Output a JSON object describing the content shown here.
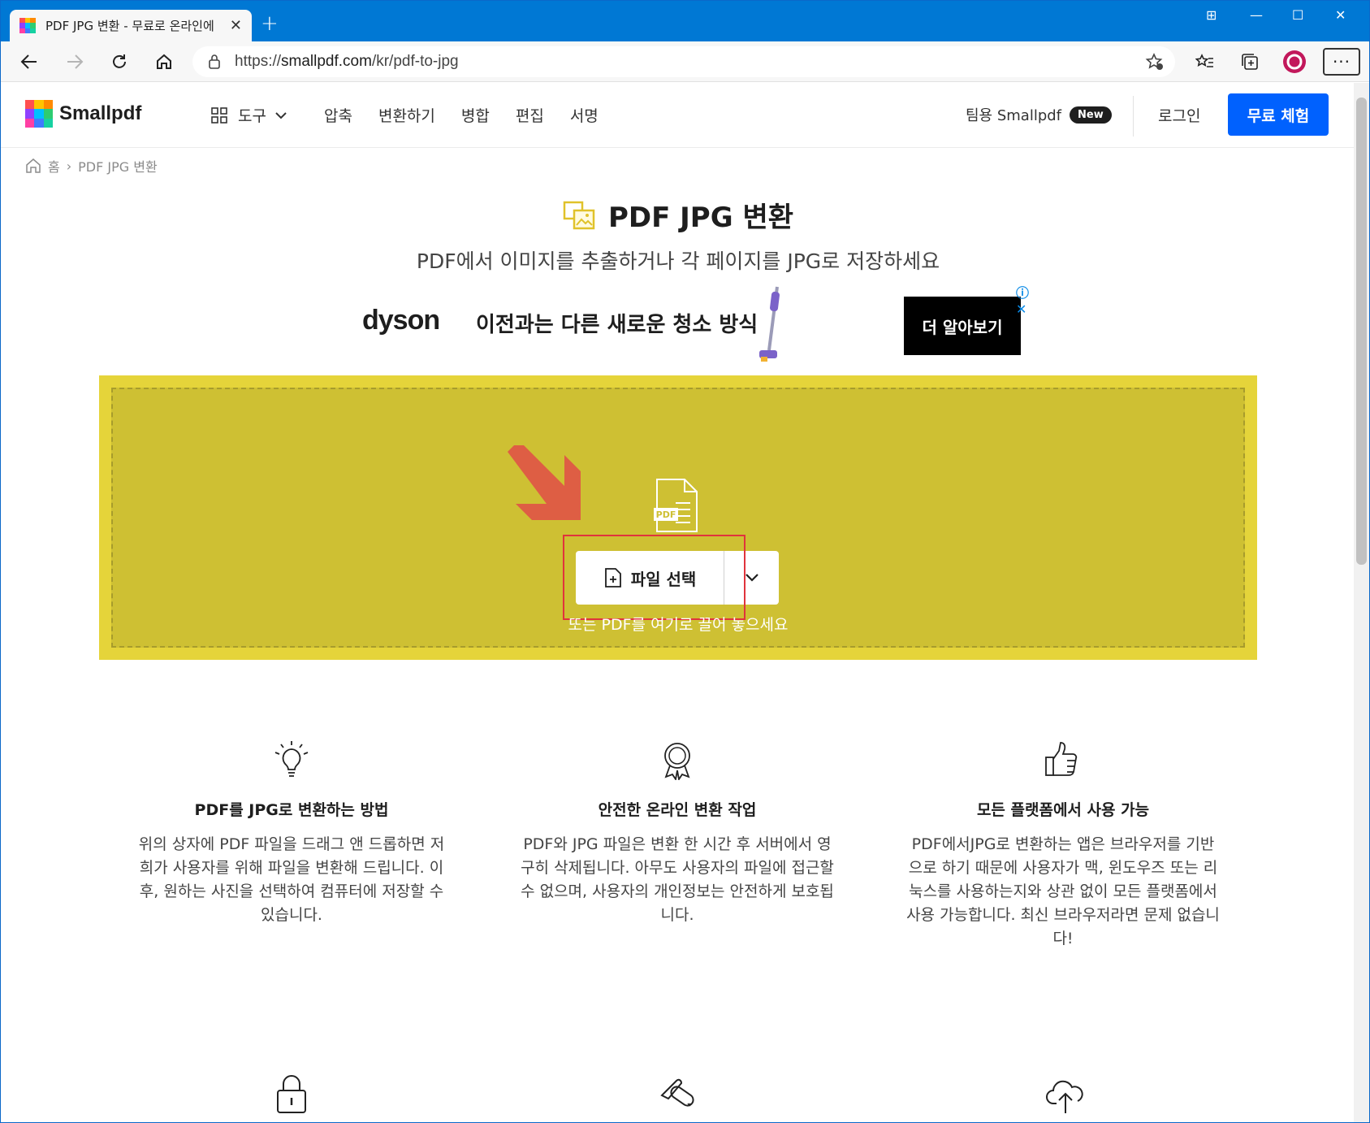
{
  "browser": {
    "tab_title": "PDF JPG 변환 - 무료로 온라인에",
    "url_prefix": "https://",
    "url_host": "smallpdf.com",
    "url_path": "/kr/pdf-to-jpg",
    "colors": {
      "titlebar": "#0078d4",
      "accent": "#0061fe"
    }
  },
  "header": {
    "logo_text": "Smallpdf",
    "tools_label": "도구",
    "menu": [
      "압축",
      "변환하기",
      "병합",
      "편집",
      "서명"
    ],
    "team_label": "팀용 Smallpdf",
    "team_badge": "New",
    "login_label": "로그인",
    "cta_label": "무료 체험"
  },
  "breadcrumb": {
    "home": "홈",
    "separator": "›",
    "current": "PDF JPG 변환"
  },
  "hero": {
    "title": "PDF JPG 변환",
    "subtitle": "PDF에서 이미지를 추출하거나 각 페이지를 JPG로 저장하세요"
  },
  "ad": {
    "brand": "dyson",
    "headline": "이전과는 다른 새로운 청소 방식",
    "button": "더 알아보기"
  },
  "dropzone": {
    "file_icon_label": "PDF",
    "choose_file": "파일 선택",
    "hint": "또는 PDF를 여기로 끌어 놓으세요",
    "colors": {
      "outer": "#e5d43a",
      "inner": "#cec033"
    }
  },
  "features": [
    {
      "icon": "lightbulb-icon",
      "title": "PDF를 JPG로 변환하는 방법",
      "body": "위의 상자에 PDF 파일을 드래그 앤 드롭하면 저희가 사용자를 위해 파일을 변환해 드립니다. 이후, 원하는 사진을 선택하여 컴퓨터에 저장할 수 있습니다."
    },
    {
      "icon": "award-icon",
      "title": "안전한 온라인 변환 작업",
      "body": "PDF와 JPG 파일은 변환 한 시간 후 서버에서 영구히 삭제됩니다. 아무도 사용자의 파일에 접근할 수 없으며, 사용자의 개인정보는 안전하게 보호됩니다."
    },
    {
      "icon": "thumbs-up-icon",
      "title": "모든 플랫폼에서 사용 가능",
      "body": "PDF에서JPG로 변환하는 앱은 브라우저를 기반으로 하기 때문에 사용자가 맥, 윈도우즈 또는 리눅스를 사용하는지와 상관 없이 모든 플랫폼에서 사용 가능합니다. 최신 브라우저라면 문제 없습니다!"
    }
  ]
}
